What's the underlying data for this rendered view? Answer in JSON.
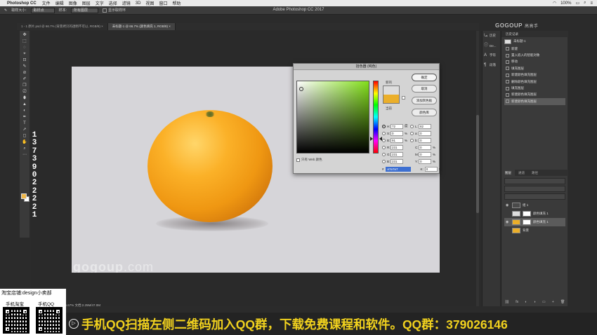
{
  "menubar": {
    "app": "Photoshop CC",
    "items": [
      "文件",
      "编辑",
      "图像",
      "图层",
      "文字",
      "选择",
      "滤镜",
      "3D",
      "视图",
      "窗口",
      "帮助"
    ],
    "battery": "100%"
  },
  "window": {
    "title": "Adobe Photoshop CC 2017"
  },
  "options": {
    "sample_size_label": "取样大小:",
    "sample_size_value": "取样点",
    "sample_label": "样本:",
    "sample_value": "所有图层",
    "show_ring_label": "显示取样环"
  },
  "tabs": [
    {
      "label": "1 - 1 原片.psd @ 66.7% (背景拷贝的透明不可以, RGB/8) ×"
    },
    {
      "label": "未标题-1 @ 66.7% (颜色填充 1, RGB/8) ×"
    }
  ],
  "toolbox": {
    "tools": [
      "✥",
      "⬚",
      "◌",
      "⌖",
      "⊡",
      "✎",
      "⊘",
      "✐",
      "❒",
      "⎚",
      "⬮",
      "▲",
      "◐",
      "✒",
      "T",
      "➚",
      "◻",
      "✋",
      "⌕",
      "⋯"
    ],
    "fg_color": "#f0b84a",
    "bg_color": "#ffffff"
  },
  "digits": [
    "1",
    "3",
    "7",
    "3",
    "9",
    "0",
    "2",
    "2",
    "2",
    "2",
    "1"
  ],
  "canvas": {
    "watermark": "gogoup",
    "watermark_suffix": ".com",
    "status": "66.67%  文档:2.25M/47.0M"
  },
  "color_picker": {
    "title": "拾色器 (纯色)",
    "new_label": "新的",
    "current_label": "当前",
    "new_color": "#dddddd",
    "current_color": "#ebaf2a",
    "buttons": {
      "ok": "确定",
      "cancel": "取消",
      "add_swatch": "添加到色板",
      "libraries": "颜色库"
    },
    "web_only": "只有 Web 颜色",
    "fields": [
      {
        "label": "H:",
        "value": "72",
        "unit": "度",
        "label2": "L:",
        "value2": "82",
        "unit2": ""
      },
      {
        "label": "S:",
        "value": "0",
        "unit": "%",
        "label2": "a:",
        "value2": "0",
        "unit2": ""
      },
      {
        "label": "B:",
        "value": "91",
        "unit": "%",
        "label2": "b:",
        "value2": "0",
        "unit2": ""
      },
      {
        "label": "R:",
        "value": "231",
        "unit": "",
        "label2": "C:",
        "value2": "0",
        "unit2": "%"
      },
      {
        "label": "G:",
        "value": "231",
        "unit": "",
        "label2": "M:",
        "value2": "0",
        "unit2": "%"
      },
      {
        "label": "B:",
        "value": "231",
        "unit": "",
        "label2": "Y:",
        "value2": "0",
        "unit2": "%"
      }
    ],
    "hex": "e7e7e7",
    "k_label": "K:",
    "k_value": "0",
    "k_unit": "%"
  },
  "right_dock": {
    "items": [
      {
        "icon": "⤿",
        "label": "历史"
      },
      {
        "icon": "ⓘ",
        "label": "De..."
      },
      {
        "icon": "A",
        "label": "字符"
      },
      {
        "icon": "¶",
        "label": "段落"
      }
    ]
  },
  "logo": {
    "text": "GOGOUP",
    "cn": "高高手"
  },
  "history": {
    "tab": "历史记录",
    "snapshot": "未标题-1",
    "items": [
      "新建",
      "置入嵌入的智能对象",
      "移动",
      "填充图层",
      "新建颜色填充图层",
      "删除颜色填充图层",
      "填充图层",
      "新建颜色填充图层",
      "新建颜色填充图层"
    ]
  },
  "layers": {
    "tabs": [
      "图层",
      "通道",
      "路径"
    ],
    "rows": [
      {
        "name": "组 1",
        "thumb": "#4a4a4a",
        "has_mask": false,
        "active": false
      },
      {
        "name": "颜色填充 1",
        "thumb": "#dddddd",
        "has_mask": true,
        "active": false
      },
      {
        "name": "颜色填充 1",
        "thumb": "#ebaf2a",
        "has_mask": true,
        "active": true
      },
      {
        "name": "背景",
        "thumb": "#ebaf2a",
        "has_mask": false,
        "active": false
      }
    ],
    "footer": [
      "⛓",
      "fx",
      "◐",
      "◑",
      "▭",
      "+",
      "🗑"
    ]
  },
  "promo": {
    "shop": "淘宝店铺:design小卖部",
    "qr1_label": "手机淘宝",
    "qr2_label": "手机QQ",
    "banner": "手机QQ扫描左侧二维码加入QQ群，下载免费课程和软件。QQ群：379026146",
    "play_icon": "▷"
  }
}
